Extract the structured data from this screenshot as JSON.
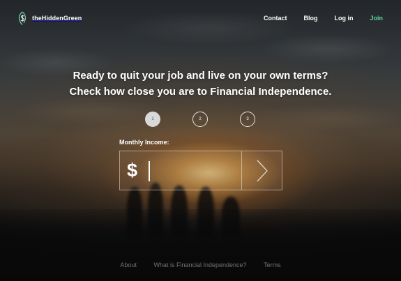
{
  "brand": {
    "name": "theHiddenGreen",
    "logo_icon": "dollar-leaf-icon"
  },
  "nav": {
    "items": [
      {
        "label": "Contact"
      },
      {
        "label": "Blog"
      },
      {
        "label": "Log in"
      },
      {
        "label": "Join"
      }
    ]
  },
  "hero": {
    "line1": "Ready to quit your job and live on your own terms?",
    "line2": "Check how close you are to Financial Independence."
  },
  "steps": [
    {
      "label": "1",
      "active": true
    },
    {
      "label": "2",
      "active": false
    },
    {
      "label": "3",
      "active": false
    }
  ],
  "form": {
    "label": "Monthly Income:",
    "currency_symbol": "$",
    "value": "",
    "next_icon": "chevron-right-icon"
  },
  "footer": {
    "links": [
      {
        "label": "About"
      },
      {
        "label": "What is Financial Independence?"
      },
      {
        "label": "Terms"
      }
    ]
  },
  "colors": {
    "join": "#5dd49a",
    "active_step": "#d9d9d9"
  }
}
